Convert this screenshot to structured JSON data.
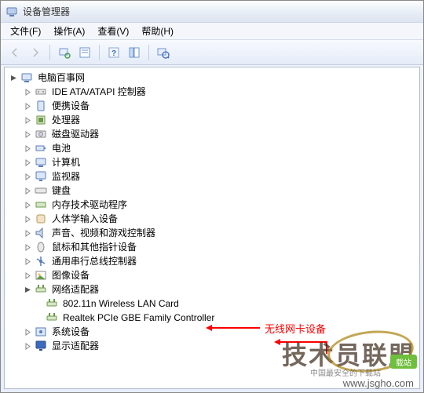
{
  "window": {
    "title": "设备管理器"
  },
  "menu": {
    "file": "文件(F)",
    "action": "操作(A)",
    "view": "查看(V)",
    "help": "帮助(H)"
  },
  "tree": {
    "root": "电脑百事网",
    "items": [
      {
        "label": "IDE ATA/ATAPI 控制器",
        "icon": "ide"
      },
      {
        "label": "便携设备",
        "icon": "portable"
      },
      {
        "label": "处理器",
        "icon": "cpu"
      },
      {
        "label": "磁盘驱动器",
        "icon": "disk"
      },
      {
        "label": "电池",
        "icon": "battery"
      },
      {
        "label": "计算机",
        "icon": "computer"
      },
      {
        "label": "监视器",
        "icon": "monitor"
      },
      {
        "label": "键盘",
        "icon": "keyboard"
      },
      {
        "label": "内存技术驱动程序",
        "icon": "memory"
      },
      {
        "label": "人体学输入设备",
        "icon": "hid"
      },
      {
        "label": "声音、视频和游戏控制器",
        "icon": "sound"
      },
      {
        "label": "鼠标和其他指针设备",
        "icon": "mouse"
      },
      {
        "label": "通用串行总线控制器",
        "icon": "usb"
      },
      {
        "label": "图像设备",
        "icon": "image"
      }
    ],
    "network": {
      "label": "网络适配器",
      "children": [
        "802.11n Wireless LAN Card",
        "Realtek PCIe GBE Family Controller"
      ]
    },
    "after": [
      {
        "label": "系统设备",
        "icon": "system"
      },
      {
        "label": "显示适配器",
        "icon": "display"
      }
    ]
  },
  "annotations": {
    "wifi": "无线网卡设备"
  },
  "watermark": {
    "big": "技术员联盟",
    "url": "www.jsgho.com",
    "sub": "中国最安全的下载站",
    "badge": "载站"
  }
}
